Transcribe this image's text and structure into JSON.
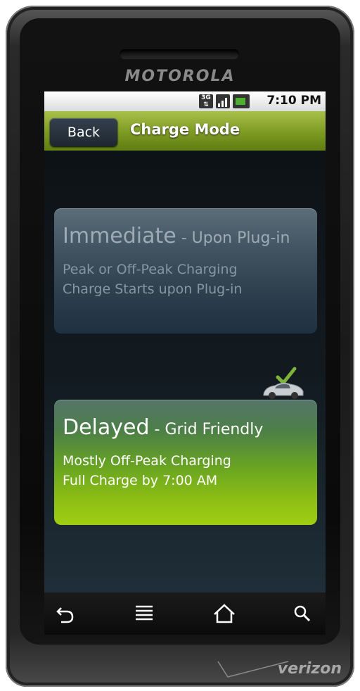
{
  "device": {
    "brand": "MOTOROLA",
    "carrier": "verizon"
  },
  "statusbar": {
    "time": "7:10 PM",
    "network": "3G"
  },
  "header": {
    "back_label": "Back",
    "title": "Charge Mode"
  },
  "options": [
    {
      "name": "Immediate",
      "subtitle": " - Upon Plug-in",
      "lines": [
        "Peak or Off-Peak Charging",
        "Charge Starts upon Plug-in"
      ],
      "selected": false
    },
    {
      "name": "Delayed",
      "subtitle": " - Grid Friendly",
      "lines": [
        "Mostly Off-Peak Charging",
        "Full Charge by 7:00 AM"
      ],
      "selected": true
    }
  ],
  "navbar": {
    "icons": [
      "back-icon",
      "menu-icon",
      "home-icon",
      "search-icon"
    ]
  },
  "colors": {
    "accent_green": "#7c9a22",
    "selected_card": "#8ebe14",
    "unselected_card": "#3f5260"
  }
}
